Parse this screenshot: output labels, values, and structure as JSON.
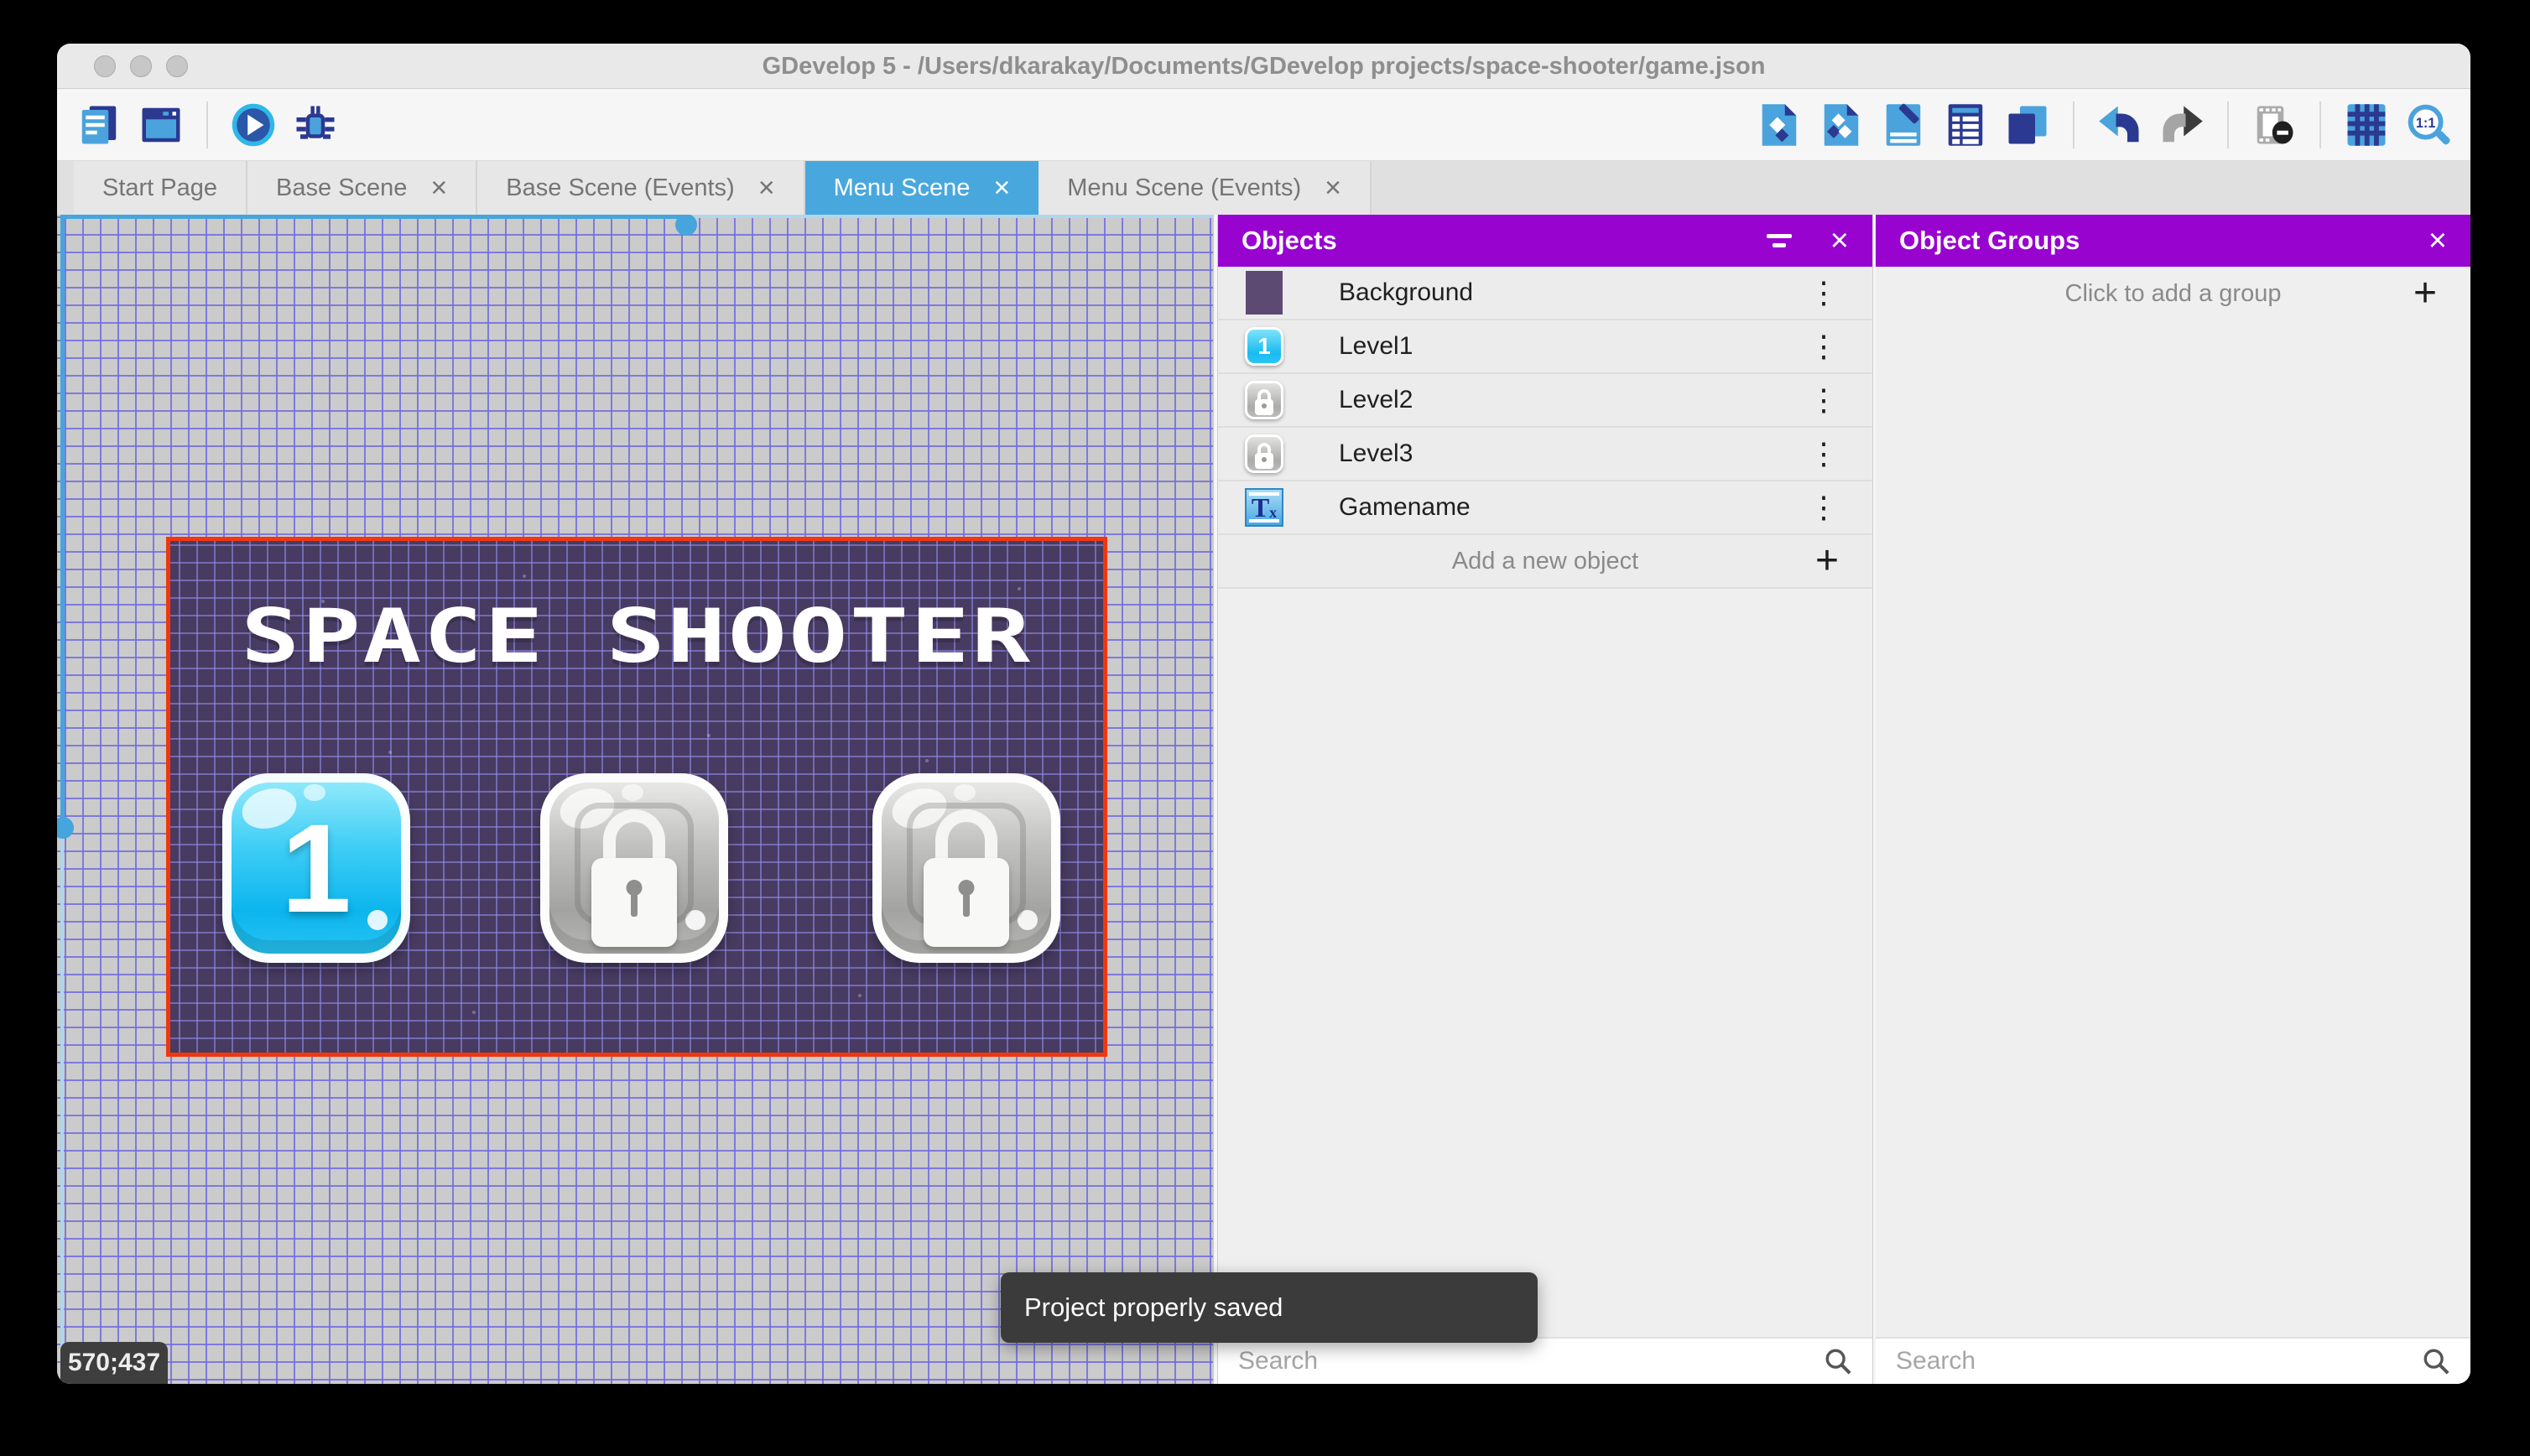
{
  "window": {
    "title": "GDevelop 5 - /Users/dkarakay/Documents/GDevelop projects/space-shooter/game.json"
  },
  "toolbar": {
    "zoom_ratio_label": "1:1"
  },
  "tabs": [
    {
      "label": "Start Page",
      "closable": false,
      "active": false
    },
    {
      "label": "Base Scene",
      "closable": true,
      "active": false
    },
    {
      "label": "Base Scene (Events)",
      "closable": true,
      "active": false
    },
    {
      "label": "Menu Scene",
      "closable": true,
      "active": true
    },
    {
      "label": "Menu Scene (Events)",
      "closable": true,
      "active": false
    }
  ],
  "canvas": {
    "coordinates": "570;437",
    "scene": {
      "title": "SPACE SHOOTER",
      "level_buttons": [
        {
          "label": "1",
          "state": "unlocked"
        },
        {
          "label": "",
          "state": "locked"
        },
        {
          "label": "",
          "state": "locked"
        }
      ]
    }
  },
  "objects_panel": {
    "title": "Objects",
    "rows": [
      {
        "name": "Background",
        "icon": "background-swatch-icon"
      },
      {
        "name": "Level1",
        "icon": "level1-button-icon"
      },
      {
        "name": "Level2",
        "icon": "locked-button-icon"
      },
      {
        "name": "Level3",
        "icon": "locked-button-icon"
      },
      {
        "name": "Gamename",
        "icon": "text-object-icon"
      }
    ],
    "add_label": "Add a new object",
    "search_placeholder": "Search"
  },
  "object_groups_panel": {
    "title": "Object Groups",
    "empty_label": "Click to add a group",
    "search_placeholder": "Search"
  },
  "toast": {
    "message": "Project properly saved"
  },
  "glyphs": {
    "close": "×",
    "plus": "+",
    "kebab": "⋮",
    "text_icon_main": "T",
    "text_icon_sub": "x"
  },
  "colors": {
    "accent_purple": "#9803CF",
    "accent_blue": "#48A8DE",
    "selection_red": "#F2360F",
    "grid_line": "#716CE0",
    "canvas_bg": "#CBCBCB",
    "scene_bg": "#483B61",
    "toast_bg": "#3B3B3B"
  }
}
